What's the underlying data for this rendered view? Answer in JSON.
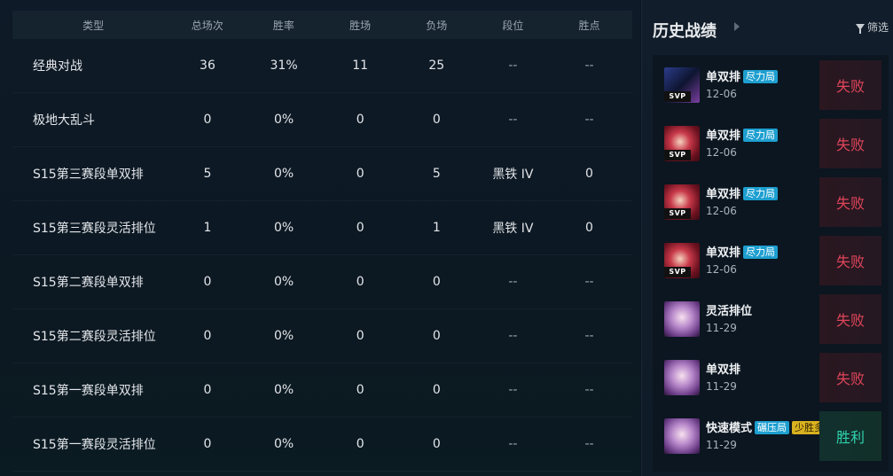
{
  "table": {
    "headers": [
      "类型",
      "总场次",
      "胜率",
      "胜场",
      "负场",
      "段位",
      "胜点"
    ],
    "rows": [
      [
        "经典对战",
        "36",
        "31%",
        "11",
        "25",
        "--",
        "--"
      ],
      [
        "极地大乱斗",
        "0",
        "0%",
        "0",
        "0",
        "--",
        "--"
      ],
      [
        "S15第三赛段单双排",
        "5",
        "0%",
        "0",
        "5",
        "黑铁 IV",
        "0"
      ],
      [
        "S15第三赛段灵活排位",
        "1",
        "0%",
        "0",
        "1",
        "黑铁 IV",
        "0"
      ],
      [
        "S15第二赛段单双排",
        "0",
        "0%",
        "0",
        "0",
        "--",
        "--"
      ],
      [
        "S15第二赛段灵活排位",
        "0",
        "0%",
        "0",
        "0",
        "--",
        "--"
      ],
      [
        "S15第一赛段单双排",
        "0",
        "0%",
        "0",
        "0",
        "--",
        "--"
      ],
      [
        "S15第一赛段灵活排位",
        "0",
        "0%",
        "0",
        "0",
        "--",
        "--"
      ]
    ]
  },
  "history": {
    "title": "历史战绩",
    "filter_label": "筛选",
    "matches": [
      {
        "mode": "单双排",
        "tag": "尽力局",
        "date": "12-06",
        "result": "失败",
        "svp": "SVP",
        "champ": "dark"
      },
      {
        "mode": "单双排",
        "tag": "尽力局",
        "date": "12-06",
        "result": "失败",
        "svp": "SVP",
        "champ": "red"
      },
      {
        "mode": "单双排",
        "tag": "尽力局",
        "date": "12-06",
        "result": "失败",
        "svp": "SVP",
        "champ": "red"
      },
      {
        "mode": "单双排",
        "tag": "尽力局",
        "date": "12-06",
        "result": "失败",
        "svp": "SVP",
        "champ": "red"
      },
      {
        "mode": "灵活排位",
        "date": "11-29",
        "result": "失败",
        "champ": "purple"
      },
      {
        "mode": "单双排",
        "date": "11-29",
        "result": "失败",
        "champ": "purple"
      },
      {
        "mode": "快速模式",
        "tag": "碾压局",
        "tag2": "少胜多",
        "date": "11-29",
        "result": "胜利",
        "champ": "purple"
      }
    ]
  }
}
